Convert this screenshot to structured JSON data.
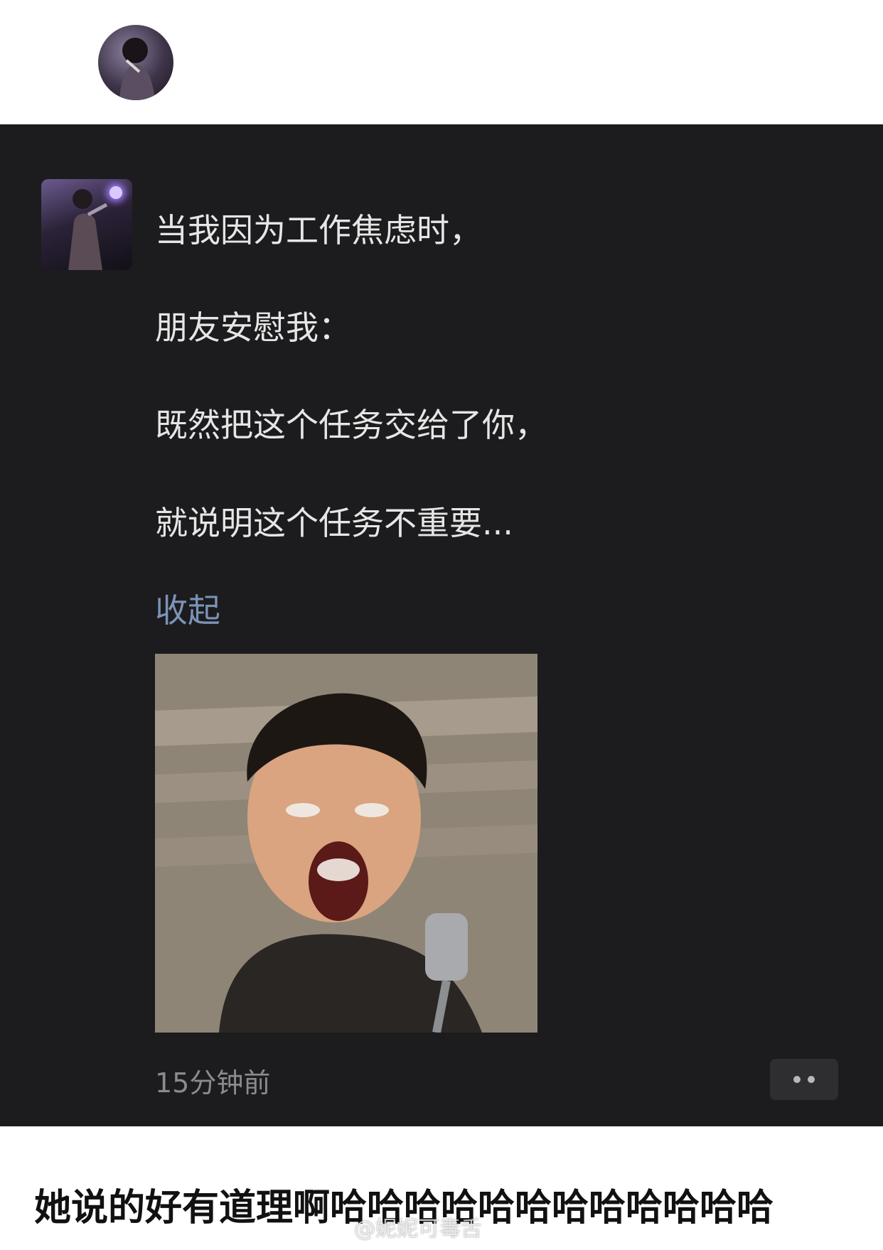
{
  "post": {
    "lines": [
      "当我因为工作焦虑时，",
      "朋友安慰我：",
      "既然把这个任务交给了你，",
      "就说明这个任务不重要..."
    ],
    "collapse_label": "收起",
    "timestamp": "15分钟前"
  },
  "caption": "她说的好有道理啊哈哈哈哈哈哈哈哈哈哈哈哈",
  "watermark": "@妮妮可毒舌",
  "icons": {
    "top_avatar": "user-avatar-icon",
    "post_avatar": "user-avatar-icon",
    "more": "more-options-icon"
  },
  "colors": {
    "panel_bg": "#1c1c1e",
    "text": "#e6e6e6",
    "link": "#7c93b8",
    "timestamp": "#8b8b8f"
  }
}
